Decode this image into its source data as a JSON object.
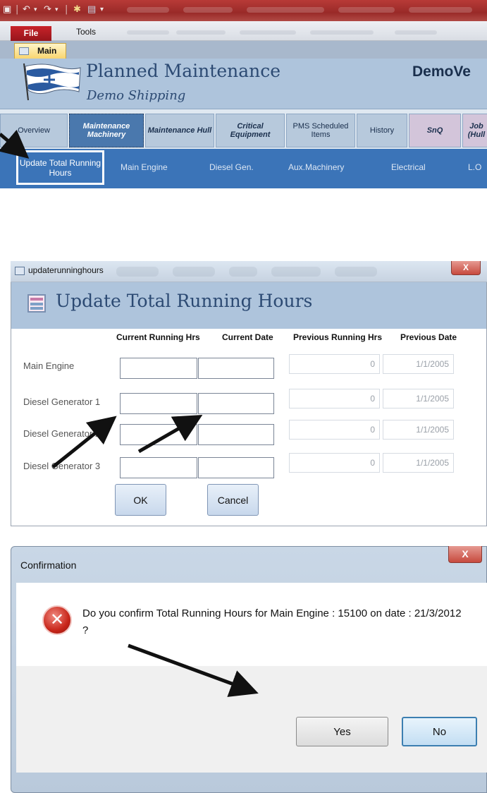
{
  "access": {
    "menu_file": "File",
    "menu_tools": "Tools",
    "doc_tab": "Main",
    "app_title": "Planned Maintenance",
    "company": "Demo Shipping",
    "vessel": "DemoVe",
    "nav_tabs": [
      {
        "label": "Overview"
      },
      {
        "label": "Maintenance Machinery"
      },
      {
        "label": "Maintenance Hull"
      },
      {
        "label": "Critical Equipment"
      },
      {
        "label": "PMS Scheduled Items"
      },
      {
        "label": "History"
      },
      {
        "label": "SnQ"
      },
      {
        "label": "Job (Hull"
      }
    ],
    "sub_tabs": [
      {
        "label": "Update Total Running Hours"
      },
      {
        "label": "Main Engine"
      },
      {
        "label": "Diesel Gen."
      },
      {
        "label": "Aux.Machinery"
      },
      {
        "label": "Electrical"
      },
      {
        "label": "L.O"
      }
    ]
  },
  "update_dialog": {
    "window_title": "updaterunninghours",
    "close_glyph": "X",
    "form_title": "Update Total Running Hours",
    "columns": [
      "Current Running Hrs",
      "Current Date",
      "Previous Running Hrs",
      "Previous Date"
    ],
    "rows": [
      {
        "label": "Main Engine",
        "current_hrs": "",
        "current_date": "",
        "previous_hrs": "0",
        "previous_date": "1/1/2005"
      },
      {
        "label": "Diesel Generator 1",
        "current_hrs": "",
        "current_date": "",
        "previous_hrs": "0",
        "previous_date": "1/1/2005"
      },
      {
        "label": "Diesel Generator 2",
        "current_hrs": "",
        "current_date": "",
        "previous_hrs": "0",
        "previous_date": "1/1/2005"
      },
      {
        "label": "Diesel Generator 3",
        "current_hrs": "",
        "current_date": "",
        "previous_hrs": "0",
        "previous_date": "1/1/2005"
      }
    ],
    "ok_label": "OK",
    "cancel_label": "Cancel"
  },
  "confirm_dialog": {
    "title": "Confirmation",
    "close_glyph": "X",
    "icon": "error-icon",
    "error_glyph": "✕",
    "message": "Do you confirm Total Running Hours for Main Engine : 15100 on date : 21/3/2012 ?",
    "yes_label": "Yes",
    "no_label": "No"
  },
  "colors": {
    "header_blue": "#aec4dc",
    "nav_active": "#4a78ad",
    "subbar": "#3b74b8",
    "title_text": "#2c4a73",
    "office_red": "#b83a37"
  }
}
